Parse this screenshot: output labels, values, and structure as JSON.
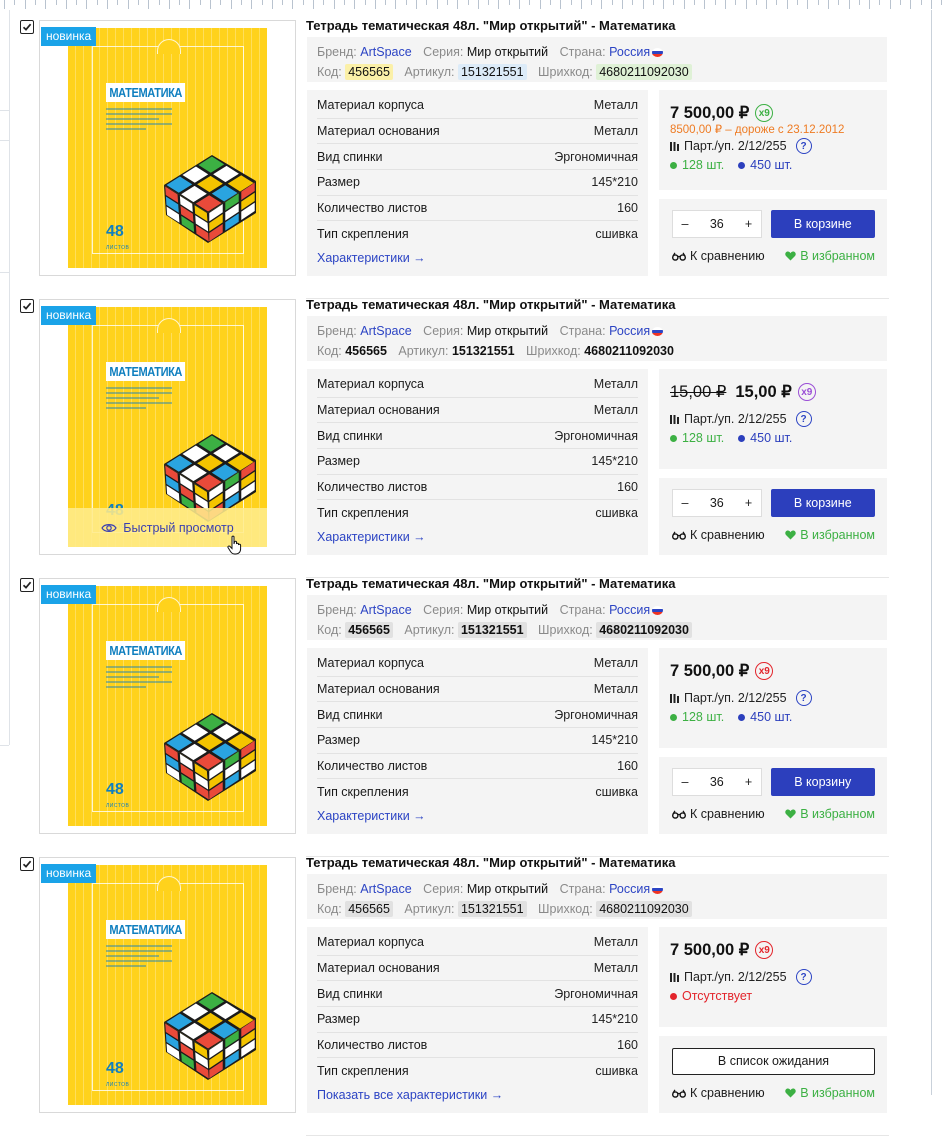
{
  "badge": "новинка",
  "quick_view": "Быстрый просмотр",
  "cover": {
    "label": "МАТЕМАТИКА",
    "number": "48",
    "number_sub": "ЛИСТОВ"
  },
  "meta_keys": {
    "brand": "Бренд:",
    "series": "Серия:",
    "country": "Страна:",
    "code": "Код:",
    "article": "Артикул:",
    "barcode": "Шрихкод:"
  },
  "spec_labels": [
    "Материал корпуса",
    "Материал основания",
    "Вид спинки",
    "Размер",
    "Количество листов",
    "Тип скрепления"
  ],
  "spec_values": [
    "Металл",
    "Металл",
    "Эргономичная",
    "145*210",
    "160",
    "сшивка"
  ],
  "actions": {
    "compare": "К сравнению",
    "favorite": "В избранном",
    "minus": "–",
    "plus": "+"
  },
  "colors": {
    "accent": "#2c3fbd",
    "badge": "#1aa3e8",
    "in_stock": "#3cb043",
    "warehouse": "#2c3fbd",
    "absent": "#e3242b",
    "warning": "#ee7b23"
  },
  "products": [
    {
      "title": "Тетрадь тематическая 48л. \"Мир открытий\" - Математика",
      "brand": "ArtSpace",
      "series": "Мир открытий",
      "country": "Россия",
      "code": "456565",
      "article": "151321551",
      "barcode": "4680211092030",
      "chip_style": "color",
      "details_link": "Характеристики →",
      "price": "7 500,00 ₽",
      "old_price": "",
      "multiplier": "x9",
      "mult_color": "g",
      "price_note": "8500,00 ₽ – дороже с 23.12.2012",
      "pack": "Парт./уп. 2/12/255",
      "stock_a": "128 шт.",
      "stock_b": "450 шт.",
      "absent": "",
      "qty": "36",
      "cart_label": "В корзине",
      "quick_view": false
    },
    {
      "title": "Тетрадь тематическая 48л. \"Мир открытий\" - Математика",
      "brand": "ArtSpace",
      "series": "Мир открытий",
      "country": "Россия",
      "code": "456565",
      "article": "151321551",
      "barcode": "4680211092030",
      "chip_style": "bold",
      "details_link": "Характеристики →",
      "price": "15,00 ₽",
      "old_price": "15,00 ₽",
      "multiplier": "x9",
      "mult_color": "p",
      "price_note": "",
      "pack": "Парт./уп. 2/12/255",
      "stock_a": "128 шт.",
      "stock_b": "450 шт.",
      "absent": "",
      "qty": "36",
      "cart_label": "В корзине",
      "quick_view": true
    },
    {
      "title": "Тетрадь тематическая 48л. \"Мир открытий\" - Математика",
      "brand": "ArtSpace",
      "series": "Мир открытий",
      "country": "Россия",
      "code": "456565",
      "article": "151321551",
      "barcode": "4680211092030",
      "chip_style": "grey-bold",
      "details_link": "Характеристики  →",
      "price": "7 500,00 ₽",
      "old_price": "",
      "multiplier": "x9",
      "mult_color": "r",
      "price_note": "",
      "pack": "Парт./уп. 2/12/255",
      "stock_a": "128 шт.",
      "stock_b": "450 шт.",
      "absent": "",
      "qty": "36",
      "cart_label": "В корзину",
      "quick_view": false
    },
    {
      "title": "Тетрадь тематическая 48л. \"Мир открытий\" - Математика",
      "brand": "ArtSpace",
      "series": "Мир открытий",
      "country": "Россия",
      "code": "456565",
      "article": "151321551",
      "barcode": "4680211092030",
      "chip_style": "grey",
      "details_link": "Показать все характеристики →",
      "price": "7 500,00 ₽",
      "old_price": "",
      "multiplier": "x9",
      "mult_color": "r",
      "price_note": "",
      "pack": "Парт./уп. 2/12/255",
      "stock_a": "",
      "stock_b": "",
      "absent": "Отсутствует",
      "qty": "",
      "cart_label": "",
      "wait_label": "В список ожидания",
      "quick_view": false
    }
  ]
}
